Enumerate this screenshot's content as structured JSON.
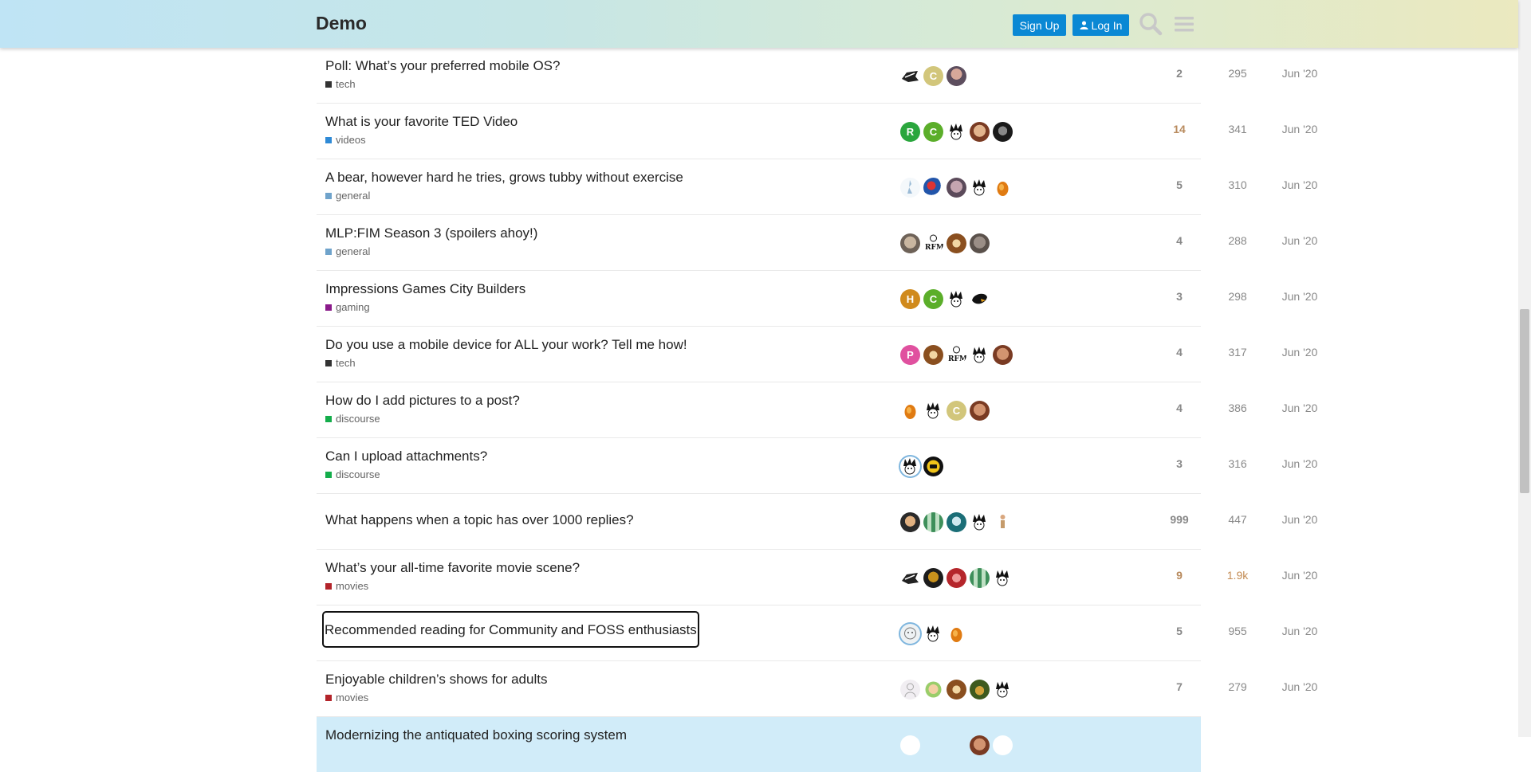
{
  "header": {
    "logo": "Demo",
    "signup_label": "Sign Up",
    "login_label": "Log In",
    "search_icon": "search-icon",
    "menu_icon": "hamburger-menu-icon"
  },
  "colors": {
    "accent": "#0a88d4",
    "highlight_row": "#d1ecf9",
    "cat_tech": "#333333",
    "cat_videos": "#2f8ad6",
    "cat_general": "#6fa3cb",
    "cat_gaming": "#8a1a8a",
    "cat_discourse": "#14ad4b",
    "cat_movies": "#b3242a"
  },
  "topics": [
    {
      "title": "Poll: What’s your preferred mobile OS?",
      "category": "tech",
      "replies": "2",
      "views": "295",
      "activity": "Jun '20"
    },
    {
      "title": "What is your favorite TED Video",
      "category": "videos",
      "replies": "14",
      "views": "341",
      "activity": "Jun '20"
    },
    {
      "title": "A bear, however hard he tries, grows tubby without exercise",
      "category": "general",
      "replies": "5",
      "views": "310",
      "activity": "Jun '20"
    },
    {
      "title": "MLP:FIM Season 3 (spoilers ahoy!)",
      "category": "general",
      "replies": "4",
      "views": "288",
      "activity": "Jun '20"
    },
    {
      "title": "Impressions Games City Builders",
      "category": "gaming",
      "replies": "3",
      "views": "298",
      "activity": "Jun '20"
    },
    {
      "title": "Do you use a mobile device for ALL your work? Tell me how!",
      "category": "tech",
      "replies": "4",
      "views": "317",
      "activity": "Jun '20"
    },
    {
      "title": "How do I add pictures to a post?",
      "category": "discourse",
      "replies": "4",
      "views": "386",
      "activity": "Jun '20"
    },
    {
      "title": "Can I upload attachments?",
      "category": "discourse",
      "replies": "3",
      "views": "316",
      "activity": "Jun '20"
    },
    {
      "title": "What happens when a topic has over 1000 replies?",
      "category": "",
      "replies": "999",
      "views": "447",
      "activity": "Jun '20"
    },
    {
      "title": "What’s your all-time favorite movie scene?",
      "category": "movies",
      "replies": "9",
      "views": "1.9k",
      "activity": "Jun '20"
    },
    {
      "title": "Recommended reading for Community and FOSS enthusiasts",
      "category": "",
      "replies": "5",
      "views": "955",
      "activity": "Jun '20"
    },
    {
      "title": "Enjoyable children’s shows for adults",
      "category": "movies",
      "replies": "7",
      "views": "279",
      "activity": "Jun '20"
    },
    {
      "title": "Modernizing the antiquated boxing scoring system",
      "category": "",
      "replies": "",
      "views": "",
      "activity": ""
    }
  ],
  "avatars": {
    "r0": [
      "C"
    ],
    "r1": [
      "R",
      "C"
    ],
    "r4": [
      "H",
      "C"
    ],
    "r5": [
      "P"
    ],
    "r6": [
      "C"
    ]
  }
}
